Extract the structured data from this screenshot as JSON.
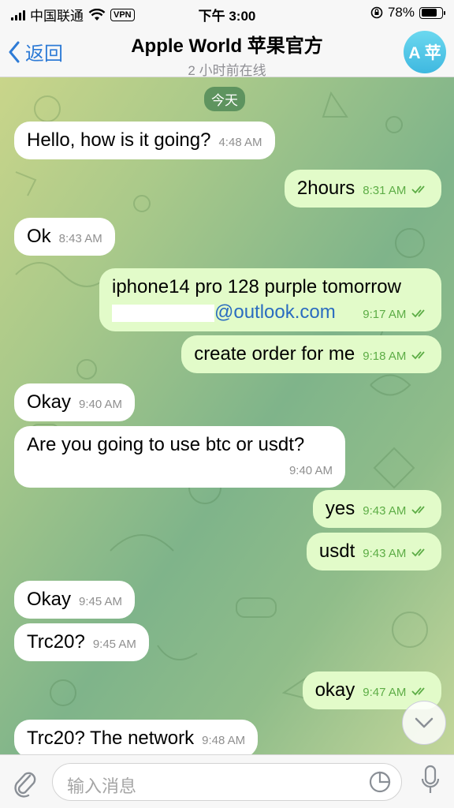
{
  "status_bar": {
    "carrier": "中国联通",
    "vpn": "VPN",
    "time": "下午 3:00",
    "battery": "78%",
    "battery_level": 0.78
  },
  "header": {
    "back_label": "返回",
    "title": "Apple World 苹果官方",
    "subtitle": "2 小时前在线",
    "avatar_text": "A 苹"
  },
  "chat": {
    "date_label": "今天",
    "messages": [
      {
        "text": "Hello, how is it going?",
        "time": "4:48 AM",
        "dir": "in"
      },
      {
        "text": "2hours",
        "time": "8:31 AM",
        "dir": "out"
      },
      {
        "text": "Ok",
        "time": "8:43 AM",
        "dir": "in"
      },
      {
        "text": "iphone14 pro 128 purple tomorrow",
        "text2": "@outlook.com",
        "time": "9:17 AM",
        "dir": "out"
      },
      {
        "text": "create order for me",
        "time": "9:18 AM",
        "dir": "out"
      },
      {
        "text": "Okay",
        "time": "9:40 AM",
        "dir": "in"
      },
      {
        "text": "Are you going to use btc or usdt?",
        "time": "9:40 AM",
        "dir": "in"
      },
      {
        "text": "yes",
        "time": "9:43 AM",
        "dir": "out"
      },
      {
        "text": "usdt",
        "time": "9:43 AM",
        "dir": "out"
      },
      {
        "text": "Okay",
        "time": "9:45 AM",
        "dir": "in"
      },
      {
        "text": "Trc20?",
        "time": "9:45 AM",
        "dir": "in"
      },
      {
        "text": "okay",
        "time": "9:47 AM",
        "dir": "out"
      },
      {
        "text": "Trc20? The network",
        "time": "9:48 AM",
        "dir": "in"
      }
    ]
  },
  "input": {
    "placeholder": "输入消息"
  },
  "colors": {
    "accent": "#2e7bd6",
    "outgoing_bubble": "#e2fbc9",
    "incoming_bubble": "#ffffff",
    "read_ticks": "#5dad46"
  }
}
